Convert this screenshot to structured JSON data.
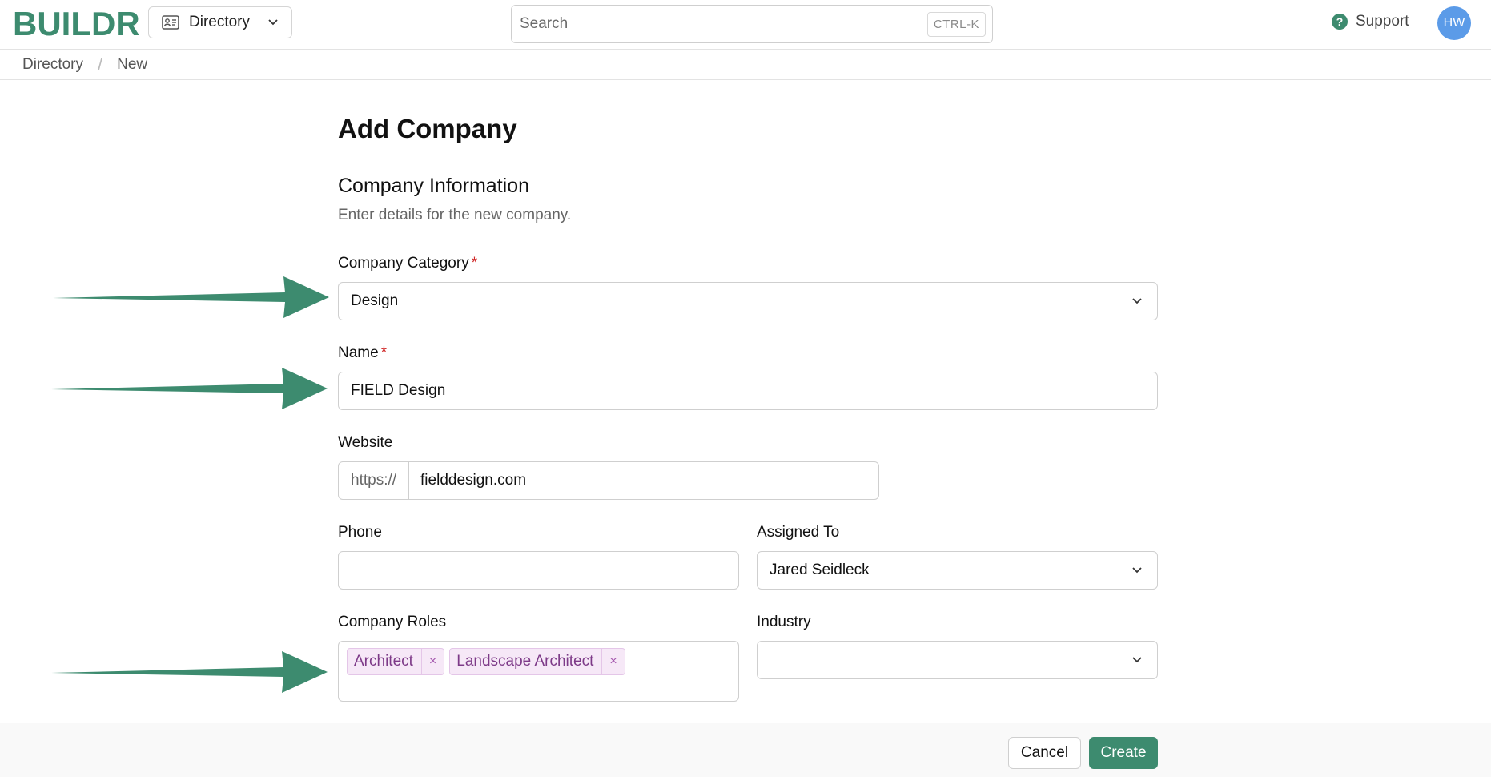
{
  "header": {
    "logo": "BUILDR",
    "module_switcher": {
      "label": "Directory",
      "icon": "contact-card-icon"
    },
    "search": {
      "placeholder": "Search",
      "shortcut": "CTRL-K"
    },
    "support_label": "Support",
    "avatar_initials": "HW"
  },
  "breadcrumb": {
    "items": [
      "Directory",
      "New"
    ],
    "separator": "/"
  },
  "form": {
    "page_title": "Add Company",
    "section_title": "Company Information",
    "section_subtitle": "Enter details for the new company.",
    "required_marker": "*",
    "company_category": {
      "label": "Company Category",
      "value": "Design",
      "required": true
    },
    "name": {
      "label": "Name",
      "value": "FIELD Design",
      "required": true
    },
    "website": {
      "label": "Website",
      "prefix": "https://",
      "value": "fielddesign.com"
    },
    "phone": {
      "label": "Phone",
      "value": ""
    },
    "assigned_to": {
      "label": "Assigned To",
      "value": "Jared Seidleck"
    },
    "company_roles": {
      "label": "Company Roles",
      "tags": [
        "Architect",
        "Landscape Architect"
      ],
      "remove_glyph": "×"
    },
    "industry": {
      "label": "Industry",
      "value": ""
    }
  },
  "footer": {
    "cancel_label": "Cancel",
    "create_label": "Create"
  },
  "colors": {
    "brand": "#3d8b6f",
    "required": "#d12b2b",
    "tag_bg": "#f6e8f7",
    "tag_text": "#7d3a88",
    "avatar": "#5b9be8"
  }
}
